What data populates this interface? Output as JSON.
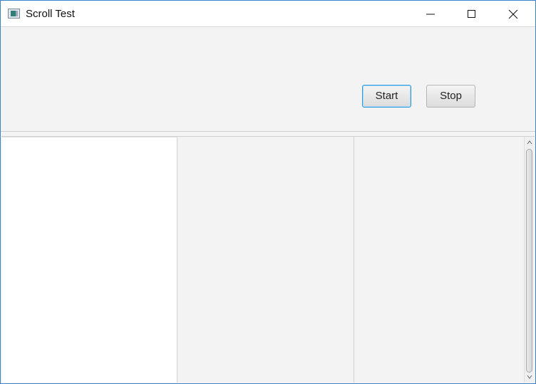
{
  "window": {
    "title": "Scroll Test",
    "icons": {
      "app": "app-window-icon",
      "minimize": "minimize-icon",
      "maximize": "maximize-icon",
      "close": "close-icon"
    }
  },
  "toolbar": {
    "start_label": "Start",
    "stop_label": "Stop"
  },
  "colors": {
    "window_border": "#3c84c9",
    "focus_border": "#2e9be0",
    "panel_bg": "#f3f3f3"
  },
  "columns": [
    {
      "name": "column-1",
      "content": ""
    },
    {
      "name": "column-2",
      "content": ""
    },
    {
      "name": "column-3",
      "content": ""
    }
  ],
  "scrollbar": {
    "icons": {
      "up": "chevron-up-icon",
      "down": "chevron-down-icon"
    }
  }
}
